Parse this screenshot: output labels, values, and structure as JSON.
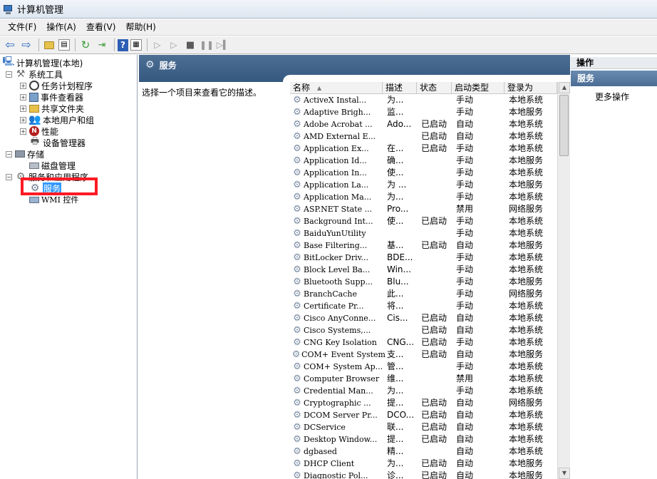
{
  "window": {
    "title": "计算机管理"
  },
  "menu": [
    "文件(F)",
    "操作(A)",
    "查看(V)",
    "帮助(H)"
  ],
  "toolbar": {
    "buttons": [
      "back-icon",
      "forward-icon",
      "up-folder-icon",
      "show-hide-tree-icon",
      "refresh-icon",
      "export-list-icon",
      "help-icon",
      "properties-icon",
      "start-service-icon",
      "play-icon",
      "stop-icon",
      "pause-icon",
      "restart-icon"
    ]
  },
  "tree": {
    "root": "计算机管理(本地)",
    "items": [
      {
        "label": "系统工具"
      },
      {
        "label": "任务计划程序"
      },
      {
        "label": "事件查看器"
      },
      {
        "label": "共享文件夹"
      },
      {
        "label": "本地用户和组"
      },
      {
        "label": "性能"
      },
      {
        "label": "设备管理器"
      },
      {
        "label": "存储"
      },
      {
        "label": "磁盘管理"
      },
      {
        "label": "服务和应用程序"
      },
      {
        "label": "服务"
      },
      {
        "label": "WMI 控件"
      }
    ]
  },
  "center": {
    "header_title": "服务",
    "description_prompt": "选择一个项目来查看它的描述。",
    "columns": [
      "名称",
      "描述",
      "状态",
      "启动类型",
      "登录为"
    ],
    "services": [
      [
        "ActiveX Instal...",
        "为...",
        "",
        "手动",
        "本地系统"
      ],
      [
        "Adaptive Brigh...",
        "监...",
        "",
        "手动",
        "本地服务"
      ],
      [
        "Adobe Acrobat ...",
        "Ado...",
        "已启动",
        "自动",
        "本地系统"
      ],
      [
        "AMD External E...",
        "",
        "已启动",
        "自动",
        "本地系统"
      ],
      [
        "Application Ex...",
        "在...",
        "已启动",
        "手动",
        "本地系统"
      ],
      [
        "Application Id...",
        "确...",
        "",
        "手动",
        "本地服务"
      ],
      [
        "Application In...",
        "使...",
        "",
        "手动",
        "本地系统"
      ],
      [
        "Application La...",
        "为 ...",
        "",
        "手动",
        "本地服务"
      ],
      [
        "Application Ma...",
        "为...",
        "",
        "手动",
        "本地系统"
      ],
      [
        "ASP.NET State ...",
        "Pro...",
        "",
        "禁用",
        "网络服务"
      ],
      [
        "Background Int...",
        "使...",
        "已启动",
        "手动",
        "本地系统"
      ],
      [
        "BaiduYunUtility",
        "",
        "",
        "手动",
        "本地系统"
      ],
      [
        "Base Filtering...",
        "基...",
        "已启动",
        "自动",
        "本地服务"
      ],
      [
        "BitLocker Driv...",
        "BDE...",
        "",
        "手动",
        "本地系统"
      ],
      [
        "Block Level Ba...",
        "Win...",
        "",
        "手动",
        "本地系统"
      ],
      [
        "Bluetooth Supp...",
        "Blu...",
        "",
        "手动",
        "本地服务"
      ],
      [
        "BranchCache",
        "此...",
        "",
        "手动",
        "网络服务"
      ],
      [
        "Certificate Pr...",
        "将...",
        "",
        "手动",
        "本地系统"
      ],
      [
        "Cisco AnyConne...",
        "Cis...",
        "已启动",
        "自动",
        "本地系统"
      ],
      [
        "Cisco Systems,...",
        "",
        "已启动",
        "自动",
        "本地系统"
      ],
      [
        "CNG Key Isolation",
        "CNG...",
        "已启动",
        "手动",
        "本地系统"
      ],
      [
        "COM+ Event System",
        "支...",
        "已启动",
        "自动",
        "本地服务"
      ],
      [
        "COM+ System Ap...",
        "管...",
        "",
        "手动",
        "本地系统"
      ],
      [
        "Computer Browser",
        "维...",
        "",
        "禁用",
        "本地系统"
      ],
      [
        "Credential Man...",
        "为...",
        "",
        "手动",
        "本地系统"
      ],
      [
        "Cryptographic ...",
        "提...",
        "已启动",
        "自动",
        "网络服务"
      ],
      [
        "DCOM Server Pr...",
        "DCO...",
        "已启动",
        "自动",
        "本地系统"
      ],
      [
        "DCService",
        "联...",
        "已启动",
        "自动",
        "本地系统"
      ],
      [
        "Desktop Window...",
        "提...",
        "已启动",
        "自动",
        "本地系统"
      ],
      [
        "dgbased",
        "精...",
        "",
        "自动",
        "本地系统"
      ],
      [
        "DHCP Client",
        "为...",
        "已启动",
        "自动",
        "本地服务"
      ],
      [
        "Diagnostic Pol...",
        "诊...",
        "已启动",
        "自动",
        "本地服务"
      ]
    ]
  },
  "actions": {
    "header": "操作",
    "section": "服务",
    "more": "更多操作"
  }
}
